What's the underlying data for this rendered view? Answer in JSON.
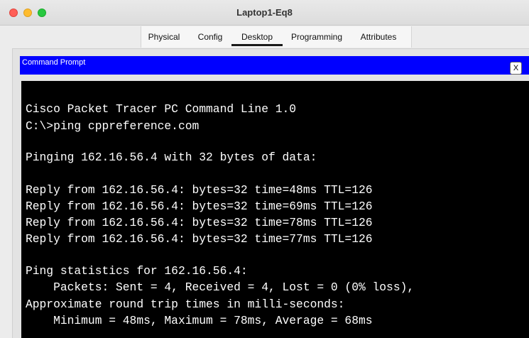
{
  "window": {
    "title": "Laptop1-Eq8",
    "controls": [
      "close-button",
      "minimize-button",
      "maximize-button"
    ]
  },
  "tabs": [
    {
      "label": "Physical",
      "active": false
    },
    {
      "label": "Config",
      "active": false
    },
    {
      "label": "Desktop",
      "active": true
    },
    {
      "label": "Programming",
      "active": false
    },
    {
      "label": "Attributes",
      "active": false
    }
  ],
  "command_prompt": {
    "title": "Command Prompt",
    "close_label": "X",
    "lines": [
      "Cisco Packet Tracer PC Command Line 1.0",
      "C:\\>ping cppreference.com",
      "Pinging 162.16.56.4 with 32 bytes of data:",
      "Reply from 162.16.56.4: bytes=32 time=48ms TTL=126",
      "Reply from 162.16.56.4: bytes=32 time=69ms TTL=126",
      "Reply from 162.16.56.4: bytes=32 time=78ms TTL=126",
      "Reply from 162.16.56.4: bytes=32 time=77ms TTL=126",
      "Ping statistics for 162.16.56.4:",
      "    Packets: Sent = 4, Received = 4, Lost = 0 (0% loss),",
      "Approximate round trip times in milli-seconds:",
      "    Minimum = 48ms, Maximum = 78ms, Average = 68ms"
    ]
  },
  "colors": {
    "prompt_header": "#0000ff",
    "terminal_bg": "#000000",
    "terminal_fg": "#ffffff",
    "close_light": "#ff5f57",
    "minimize_light": "#febc2e",
    "maximize_light": "#28c840"
  }
}
